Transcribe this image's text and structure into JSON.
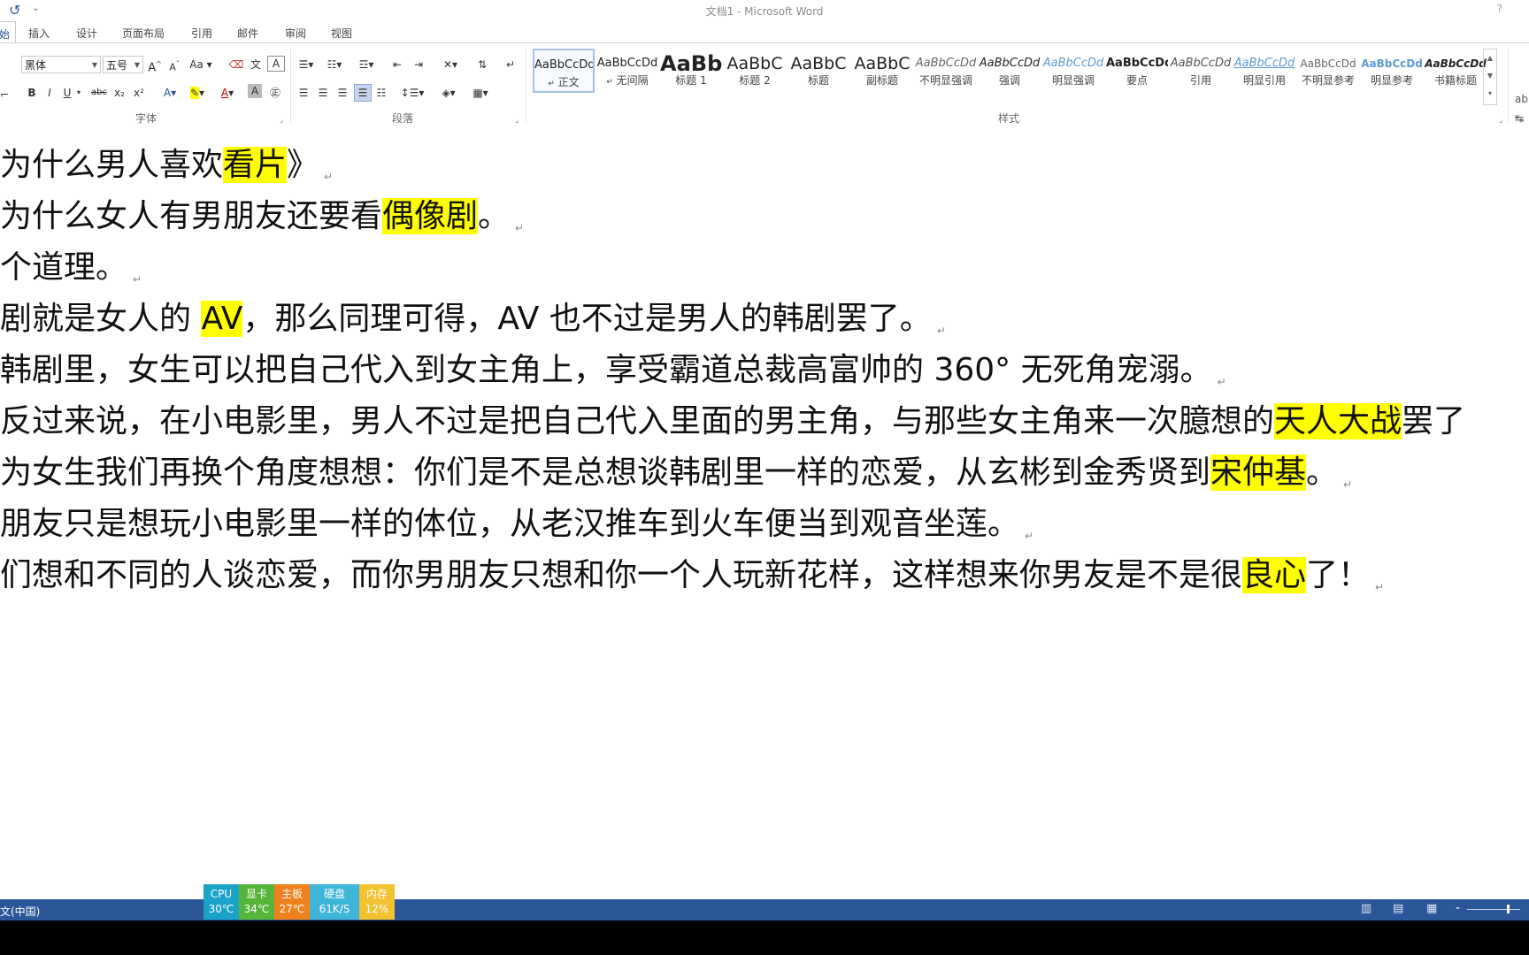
{
  "titlebar": {
    "title": "文档1 - Microsoft Word",
    "help": "?"
  },
  "tabs": [
    "开始",
    "插入",
    "设计",
    "页面布局",
    "引用",
    "邮件",
    "审阅",
    "视图"
  ],
  "ribbon": {
    "font": {
      "name": "黑体",
      "size": "五号",
      "grow": "A",
      "shrink": "A",
      "case": "Aa",
      "bold": "B",
      "italic": "I",
      "underline": "U",
      "strike": "abc",
      "subscript": "x₂",
      "superscript": "x²",
      "group_label": "字体"
    },
    "paragraph": {
      "group_label": "段落"
    },
    "styles": {
      "group_label": "样式",
      "items": [
        {
          "sample": "AaBbCcDd",
          "name": "正文"
        },
        {
          "sample": "AaBbCcDd",
          "name": "无间隔"
        },
        {
          "sample": "AaBb",
          "name": "标题 1"
        },
        {
          "sample": "AaBbC",
          "name": "标题 2"
        },
        {
          "sample": "AaBbC",
          "name": "标题"
        },
        {
          "sample": "AaBbC",
          "name": "副标题"
        },
        {
          "sample": "AaBbCcDd",
          "name": "不明显强调"
        },
        {
          "sample": "AaBbCcDd",
          "name": "强调"
        },
        {
          "sample": "AaBbCcDd",
          "name": "明显强调"
        },
        {
          "sample": "AaBbCcDd",
          "name": "要点"
        },
        {
          "sample": "AaBbCcDd",
          "name": "引用"
        },
        {
          "sample": "AaBbCcDd",
          "name": "明显引用"
        },
        {
          "sample": "AaBbCcDd",
          "name": "不明显参考"
        },
        {
          "sample": "AaBbCcDd",
          "name": "明显参考"
        },
        {
          "sample": "AaBbCcDd",
          "name": "书籍标题"
        }
      ]
    }
  },
  "document": {
    "lines": [
      {
        "parts": [
          {
            "t": "为什么男人喜欢"
          },
          {
            "t": "看片",
            "hl": true
          },
          {
            "t": "》"
          }
        ]
      },
      {
        "parts": [
          {
            "t": "为什么女人有男朋友还要看"
          },
          {
            "t": "偶像剧",
            "hl": true
          },
          {
            "t": "。"
          }
        ]
      },
      {
        "parts": [
          {
            "t": "个道理。"
          }
        ]
      },
      {
        "parts": [
          {
            "t": "剧就是女人的 "
          },
          {
            "t": "AV",
            "hl": true
          },
          {
            "t": "，那么同理可得，AV 也不过是男人的韩剧罢了。"
          }
        ]
      },
      {
        "parts": [
          {
            "t": "韩剧里，女生可以把自己代入到女主角上，享受霸道总裁高富帅的 360° 无死角宠溺。"
          }
        ]
      },
      {
        "parts": [
          {
            "t": "反过来说，在小电影里，男人不过是把自己代入里面的男主角，与那些女主角来一次臆想的"
          },
          {
            "t": "天人大战",
            "hl": true
          },
          {
            "t": "罢了"
          }
        ]
      },
      {
        "parts": [
          {
            "t": "为女生我们再换个角度想想：你们是不是总想谈韩剧里一样的恋爱，从玄彬到金秀贤到"
          },
          {
            "t": "宋仲基",
            "hl": true
          },
          {
            "t": "。"
          }
        ]
      },
      {
        "parts": [
          {
            "t": "朋友只是想玩小电影里一样的体位，从老汉推车到火车便当到观音坐莲。"
          }
        ]
      },
      {
        "parts": [
          {
            "t": "们想和不同的人谈恋爱，而你男朋友只想和你一个人玩新花样，这样想来你男友是不是很"
          },
          {
            "t": "良心",
            "hl": true
          },
          {
            "t": "了！"
          }
        ]
      }
    ],
    "paragraph_mark": "↵"
  },
  "statusbar": {
    "language": "文(中国)",
    "zoom_minus": "-"
  },
  "hw_monitor": [
    {
      "label": "CPU",
      "value": "30℃",
      "color": "#1aa3c8"
    },
    {
      "label": "显卡",
      "value": "34℃",
      "color": "#55b53a"
    },
    {
      "label": "主板",
      "value": "27℃",
      "color": "#f0821e"
    },
    {
      "label": "硬盘",
      "value": "61K/S",
      "color": "#3fb4d9"
    },
    {
      "label": "内存",
      "value": "12%",
      "color": "#f2c230"
    }
  ]
}
